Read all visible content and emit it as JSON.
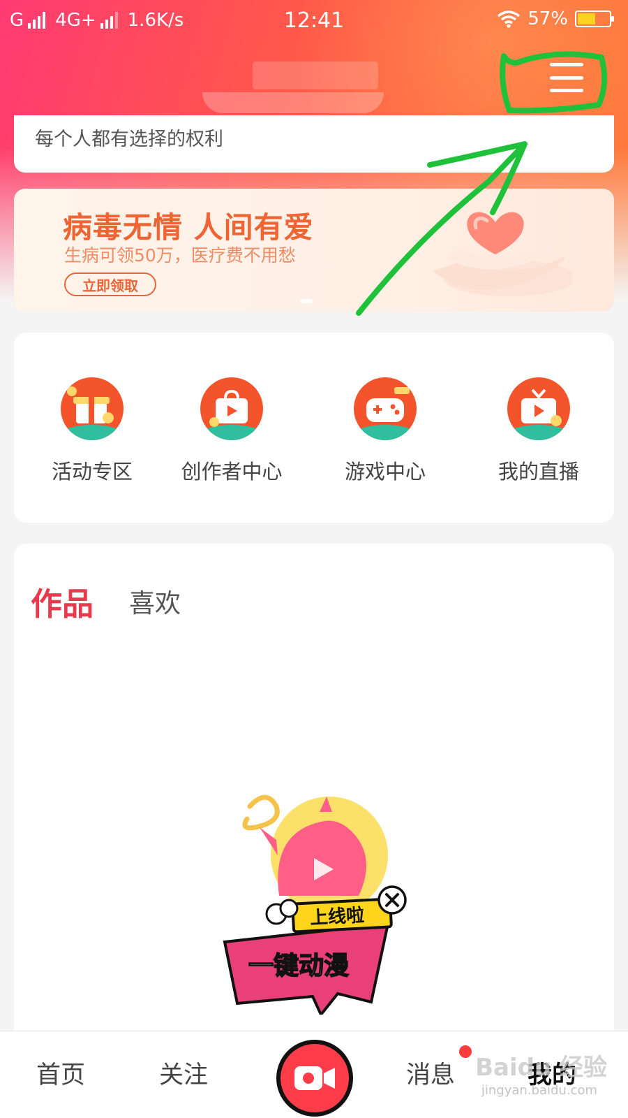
{
  "status_bar": {
    "carrier1": "G",
    "carrier2": "4G+",
    "speed": "1.6K/s",
    "time": "12:41",
    "battery": "57%",
    "battery_level": 0.57
  },
  "header": {
    "menu_icon": "menu-icon"
  },
  "profile": {
    "slogan": "每个人都有选择的权利"
  },
  "banner": {
    "title": "病毒无情 人间有爱",
    "subtitle": "生病可领50万，医疗费不用愁",
    "cta": "立即领取"
  },
  "quick_links": [
    {
      "label": "活动专区",
      "icon": "gift-box-icon"
    },
    {
      "label": "创作者中心",
      "icon": "video-bag-icon"
    },
    {
      "label": "游戏中心",
      "icon": "gamepad-icon"
    },
    {
      "label": "我的直播",
      "icon": "live-tv-icon"
    }
  ],
  "content_tabs": {
    "works": "作品",
    "likes": "喜欢"
  },
  "promo": {
    "tag": "上线啦",
    "title": "一键动漫"
  },
  "bottom_nav": {
    "home": "首页",
    "follow": "关注",
    "messages": "消息",
    "mine": "我的"
  },
  "watermark": {
    "brand": "Baidu 经验",
    "url": "jingyan.baidu.com"
  },
  "colors": {
    "accent": "#e83a4c",
    "header_start": "#ff3a72",
    "header_end": "#ff7a35",
    "annotation": "#1fc13a"
  }
}
